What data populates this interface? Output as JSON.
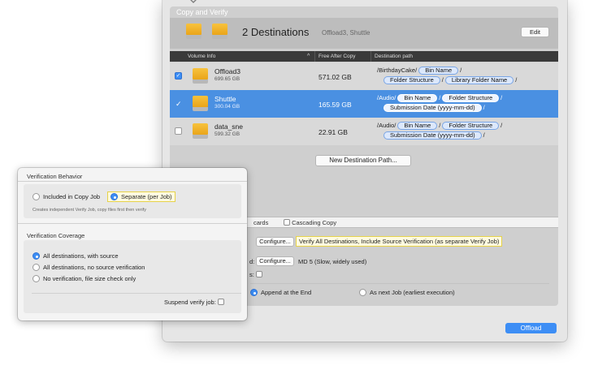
{
  "panel": {
    "title": "Copy and Verify"
  },
  "destinations": {
    "count_label": "2 Destinations",
    "names_label": "Offload3, Shuttle",
    "edit_label": "Edit"
  },
  "table": {
    "headers": {
      "volume_info": "Volume Info",
      "free_after_copy": "Free After Copy",
      "destination_path": "Destination path"
    },
    "rows": [
      {
        "checked": true,
        "name": "Offload3",
        "size": "699.65 GB",
        "free": "571.02 GB",
        "path1_prefix": "/BirthdayCake/",
        "path1_token": "Bin Name",
        "path1_suffix": "/",
        "path2_token1": "Folder Structure",
        "path2_sep": "/",
        "path2_token2": "Library Folder Name",
        "path2_suffix": "/"
      },
      {
        "checked": true,
        "name": "Shuttle",
        "size": "300.04 GB",
        "free": "165.59 GB",
        "path1_prefix": "/Audio/",
        "path1_token1": "Bin Name",
        "path1_sep": "/",
        "path1_token2": "Folder Structure",
        "path1_suffix": "/",
        "path2_token": "Submission Date (yyyy-mm-dd)",
        "path2_suffix": "/"
      },
      {
        "checked": false,
        "name": "data_sne",
        "size": "599.32 GB",
        "free": "22.91 GB",
        "path1_prefix": "/Audio/",
        "path1_token1": "Bin Name",
        "path1_sep": "/",
        "path1_token2": "Folder Structure",
        "path1_suffix": "/",
        "path2_token": "Submission Date (yyyy-mm-dd)",
        "path2_suffix": "/"
      }
    ]
  },
  "new_destination_label": "New Destination Path...",
  "options": {
    "tab_partial": "cards",
    "cascading_label": "Cascading Copy",
    "configure_label": "Configure...",
    "verify_summary": "Verify All Destinations, Include Source Verification (as separate Verify Job)",
    "hash_row_prefix": "d:",
    "hash_summary": "MD 5 (Slow, widely used)",
    "s_row_prefix": "s:",
    "append_end_label": "Append at the End",
    "next_job_label": "As next Job (earliest execution)"
  },
  "offload_label": "Offload",
  "popover": {
    "behavior_title": "Verification Behavior",
    "included_label": "Included in Copy Job",
    "separate_label": "Separate (per Job)",
    "behavior_hint": "Creates independent Verify Job, copy files first then verify",
    "coverage_title": "Verification Coverage",
    "coverage_options": [
      "All destinations, with source",
      "All destinations, no source verification",
      "No verification, file size check only"
    ],
    "selected_coverage": 0,
    "suspend_label": "Suspend verify job:"
  },
  "colors": {
    "accent": "#3d8ef5",
    "selection": "#4a90e2",
    "drive": "#f2b632",
    "highlight_border": "#e6d24a"
  }
}
